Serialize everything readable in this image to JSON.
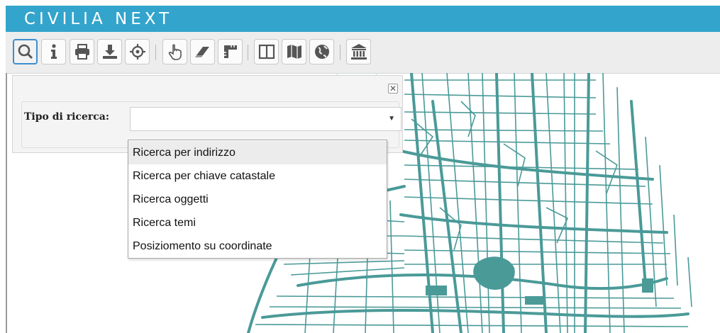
{
  "app": {
    "title": "CIVILIA NEXT"
  },
  "toolbar": {
    "buttons": [
      {
        "name": "search-icon",
        "active": true
      },
      {
        "name": "info-icon"
      },
      {
        "name": "print-icon"
      },
      {
        "name": "download-icon"
      },
      {
        "name": "locate-icon"
      },
      {
        "name": "hand-pointer-icon"
      },
      {
        "name": "eraser-icon"
      },
      {
        "name": "measure-icon"
      },
      {
        "name": "split-view-icon"
      },
      {
        "name": "map-icon"
      },
      {
        "name": "globe-icon"
      },
      {
        "name": "building-icon"
      }
    ]
  },
  "search_panel": {
    "label": "Tipo di ricerca:",
    "selected_value": "",
    "close_glyph": "✕"
  },
  "dropdown": {
    "highlighted_index": 0,
    "options": [
      "Ricerca per indirizzo",
      "Ricerca per chiave catastale",
      "Ricerca oggetti",
      "Ricerca temi",
      "Posiziomento su coordinate"
    ]
  },
  "colors": {
    "header": "#33a4cc",
    "map_lines": "#4a9a98",
    "active_border": "#3d8ed0"
  }
}
